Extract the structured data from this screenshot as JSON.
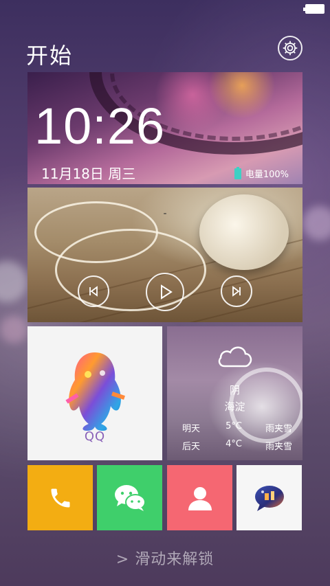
{
  "header": {
    "title": "开始",
    "settings_icon": "gear-icon"
  },
  "clock": {
    "time": "10:26",
    "date": "11月18日  周三",
    "battery_label": "电量100%",
    "battery_icon": "battery-icon",
    "accent": "#3fd0c4"
  },
  "music": {
    "track_title": "-",
    "prev_icon": "skip-previous-icon",
    "play_icon": "play-icon",
    "next_icon": "skip-next-icon"
  },
  "qq": {
    "label": "QQ",
    "label_color": "#8a62b8"
  },
  "weather": {
    "icon": "cloud-icon",
    "condition": "阴",
    "location": "海淀",
    "forecast": [
      {
        "day": "明天",
        "temp": "5°C",
        "desc": "雨夹雪"
      },
      {
        "day": "后天",
        "temp": "4°C",
        "desc": "雨夹雪"
      }
    ]
  },
  "apps": [
    {
      "name": "phone",
      "icon": "phone-icon",
      "color": "#f3ad12"
    },
    {
      "name": "wechat",
      "icon": "wechat-icon",
      "color": "#3fcf6b"
    },
    {
      "name": "contacts",
      "icon": "contact-icon",
      "color": "#f56772"
    },
    {
      "name": "messages",
      "icon": "message-icon",
      "color": "#f6f6f6"
    }
  ],
  "unlock_hint": "> 滑动来解锁"
}
